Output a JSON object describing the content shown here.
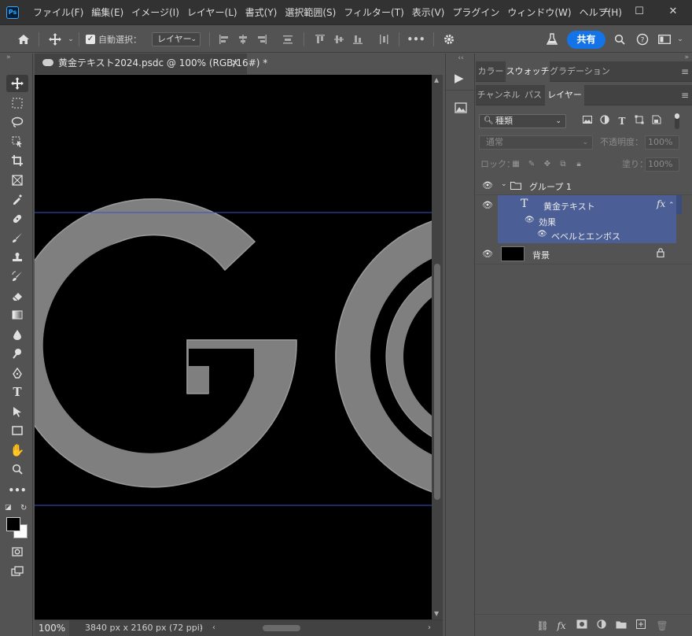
{
  "app": {
    "logo_text": "Ps",
    "menu": [
      "ファイル(F)",
      "編集(E)",
      "イメージ(I)",
      "レイヤー(L)",
      "書式(Y)",
      "選択範囲(S)",
      "フィルター(T)",
      "表示(V)",
      "プラグイン",
      "ウィンドウ(W)",
      "ヘルプ(H)"
    ],
    "window_controls": {
      "minimize": "—",
      "maximize": "☐",
      "close": "✕"
    }
  },
  "options_bar": {
    "auto_select_label": "自動選択：",
    "auto_select_checked": true,
    "layer_target": "レイヤー",
    "more": "•••",
    "share_label": "共有"
  },
  "document": {
    "tab_title": "黄金テキスト2024.psdc @ 100% (RGB/16#) *",
    "close": "✕",
    "zoom": "100%",
    "size_info": "3840 px x 2160 px (72 ppi)",
    "canvas_text": "GO",
    "text_color": "#7f7f7f",
    "background_color": "#000000",
    "guide_color": "#3a4fd0"
  },
  "panels": {
    "top_tabs": [
      "カラー",
      "スウォッチ",
      "グラデーション"
    ],
    "top_active": "スウォッチ",
    "layer_tabs": [
      "チャンネル",
      "パス",
      "レイヤー"
    ],
    "layer_active": "レイヤー",
    "filter_kind": "種類",
    "blend_mode": "通常",
    "opacity_label": "不透明度：",
    "opacity_value": "100%",
    "lock_label": "ロック：",
    "fill_label": "塗り：",
    "fill_value": "100%"
  },
  "layers": [
    {
      "name": "グループ 1",
      "kind": "group",
      "selected": false
    },
    {
      "name": "黄金テキスト",
      "kind": "text",
      "selected": true,
      "fx": "fx"
    },
    {
      "name": "効果",
      "kind": "effects",
      "selected": true
    },
    {
      "name": "ベベルとエンボス",
      "kind": "effect",
      "selected": true
    },
    {
      "name": "背景",
      "kind": "background",
      "selected": false
    }
  ],
  "colors": {
    "accent": "#1473e6",
    "selection": "#4b5f96",
    "foreground": "#000000",
    "background": "#ffffff"
  }
}
